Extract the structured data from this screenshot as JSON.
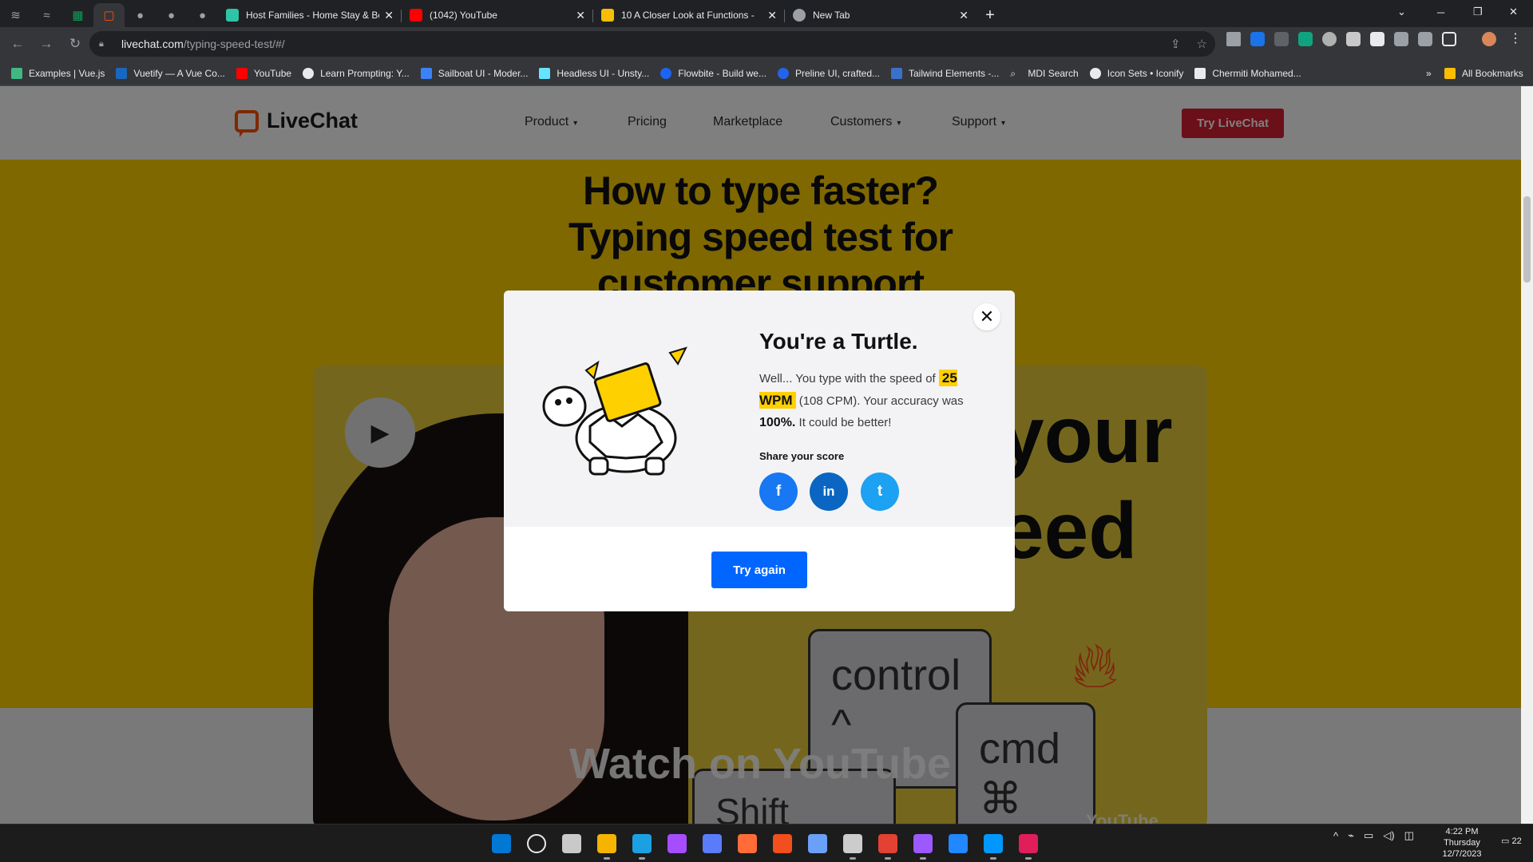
{
  "browser": {
    "tabs": [
      {
        "title": "Host Families - Home Stay & Be",
        "color": "#2ec4a6"
      },
      {
        "title": "(1042) YouTube",
        "color": "#ff0000"
      },
      {
        "title": "10 A Closer Look at Functions - ",
        "color": "#fbbc04"
      },
      {
        "title": "New Tab",
        "color": "#9aa0a6"
      }
    ],
    "new_tab_symbol": "+",
    "close_symbol": "✕",
    "url_host": "livechat.com",
    "url_path": "/typing-speed-test/#/",
    "bookmarks": [
      {
        "label": "Examples | Vue.js",
        "color": "#41b883"
      },
      {
        "label": "Vuetify — A Vue Co...",
        "color": "#1867c0"
      },
      {
        "label": "YouTube",
        "color": "#ff0000"
      },
      {
        "label": "Learn Prompting: Y...",
        "color": "#e8eaed"
      },
      {
        "label": "Sailboat UI - Moder...",
        "color": "#3b82f6"
      },
      {
        "label": "Headless UI - Unsty...",
        "color": "#66e3ff"
      },
      {
        "label": "Flowbite - Build we...",
        "color": "#1c64f2"
      },
      {
        "label": "Preline UI, crafted...",
        "color": "#2563eb"
      },
      {
        "label": "Tailwind Elements -...",
        "color": "#3b71ca"
      },
      {
        "label": "MDI Search",
        "color": "#e8eaed"
      },
      {
        "label": "Icon Sets • Iconify",
        "color": "#e8eaed"
      },
      {
        "label": "Chermiti Mohamed...",
        "color": "#e8eaed"
      }
    ],
    "all_bookmarks": "All Bookmarks",
    "overflow": "»"
  },
  "site": {
    "logo": "LiveChat",
    "nav": [
      {
        "label": "Product",
        "caret": "▾"
      },
      {
        "label": "Pricing",
        "caret": ""
      },
      {
        "label": "Marketplace",
        "caret": ""
      },
      {
        "label": "Customers",
        "caret": "▾"
      },
      {
        "label": "Support",
        "caret": "▾"
      }
    ],
    "cta": "Try LiveChat",
    "hero_line1": "How to type faster?",
    "hero_line2": "Typing speed test for",
    "hero_line3": "customer support",
    "video_word1": "your",
    "video_word2": "eed",
    "key_control": "control",
    "key_control_sym": "^",
    "key_cmd": "cmd",
    "key_cmd_sym": "⌘",
    "key_shift": "Shift",
    "watch": "Watch on YouTube",
    "yt_brand": "YouTube"
  },
  "modal": {
    "title": "You're a Turtle.",
    "msg_pre": "Well... You type with the speed of",
    "wpm": "25 WPM",
    "cpm": "(108 CPM). Your accuracy was",
    "accuracy": "100%.",
    "msg_post": "It could be better!",
    "share_label": "Share your score",
    "social": [
      {
        "label": "f",
        "color": "#1877f2"
      },
      {
        "label": "in",
        "color": "#0a66c2"
      },
      {
        "label": "t",
        "color": "#1da1f2"
      }
    ],
    "try_again": "Try again",
    "close": "✕"
  },
  "taskbar": {
    "time": "4:22 PM",
    "day": "Thursday",
    "date": "12/7/2023",
    "notifications": "22",
    "apps": [
      "#0078d4",
      "#e8eaed",
      "#c9c9c9",
      "#f4b400",
      "#1ba1e2",
      "#a64dff",
      "#5b7cfa",
      "#ff6c37",
      "#f24e1e",
      "#6aa0f8",
      "#cccccc",
      "#e34133",
      "#9b59ff",
      "#2188ff",
      "#0098ff",
      "#e01e5a"
    ]
  },
  "colors": {
    "accent": "#ffd000",
    "brand": "#ff5100",
    "cta": "#d61f33",
    "primary": "#0066ff"
  }
}
